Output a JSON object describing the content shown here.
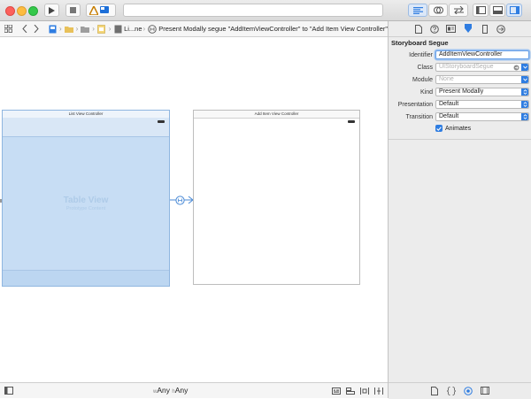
{
  "jumpbar": {
    "crumb_short": "Li...ne",
    "segue_path": "Present Modally segue \"AddItemViewController\" to \"Add Item View Controller\""
  },
  "canvas": {
    "scene1": {
      "title": "List View Controller",
      "table_title": "Table View",
      "table_subtitle": "Prototype Content"
    },
    "scene2": {
      "title": "Add Item View Controller"
    }
  },
  "bottombar": {
    "w_prefix": "w",
    "w_value": "Any",
    "h_prefix": "h",
    "h_value": "Any"
  },
  "inspector": {
    "section_title": "Storyboard Segue",
    "identifier_label": "Identifier",
    "identifier_value": "AddItemViewController",
    "class_label": "Class",
    "class_placeholder": "UIStoryboardSegue",
    "module_label": "Module",
    "module_placeholder": "None",
    "kind_label": "Kind",
    "kind_value": "Present Modally",
    "presentation_label": "Presentation",
    "presentation_value": "Default",
    "transition_label": "Transition",
    "transition_value": "Default",
    "animates_label": "Animates",
    "animates_checked": true
  },
  "colors": {
    "accent": "#2f7de1",
    "selection_fill": "#c9dff5",
    "selection_border": "#8fb6e0"
  }
}
